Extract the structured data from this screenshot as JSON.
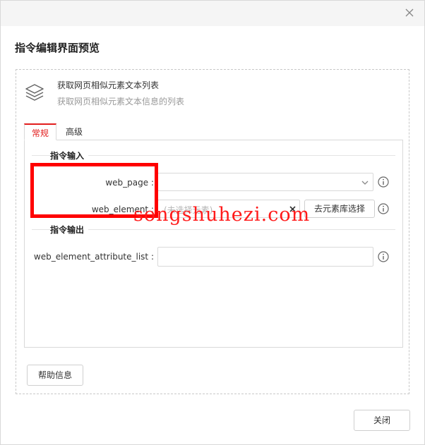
{
  "dialog": {
    "title": "指令编辑界面预览",
    "close_button_label": "关闭"
  },
  "command": {
    "icon": "layers-icon",
    "name": "获取网页相似元素文本列表",
    "description": "获取网页相似元素文本信息的列表"
  },
  "tabs": [
    {
      "label": "常规",
      "active": true
    },
    {
      "label": "高级",
      "active": false
    }
  ],
  "sections": {
    "input": "指令输入",
    "output": "指令输出"
  },
  "fields": {
    "web_page": {
      "label": "web_page :",
      "value": ""
    },
    "web_element": {
      "label": "web_element :",
      "placeholder": "(未选择元素)",
      "button": "去元素库选择"
    },
    "web_element_attribute_list": {
      "label": "web_element_attribute_list :",
      "value": ""
    }
  },
  "help_button_label": "帮助信息",
  "watermark": "songshuhezi.com",
  "colors": {
    "accent": "#e21d1d",
    "highlight": "#ff0000"
  }
}
